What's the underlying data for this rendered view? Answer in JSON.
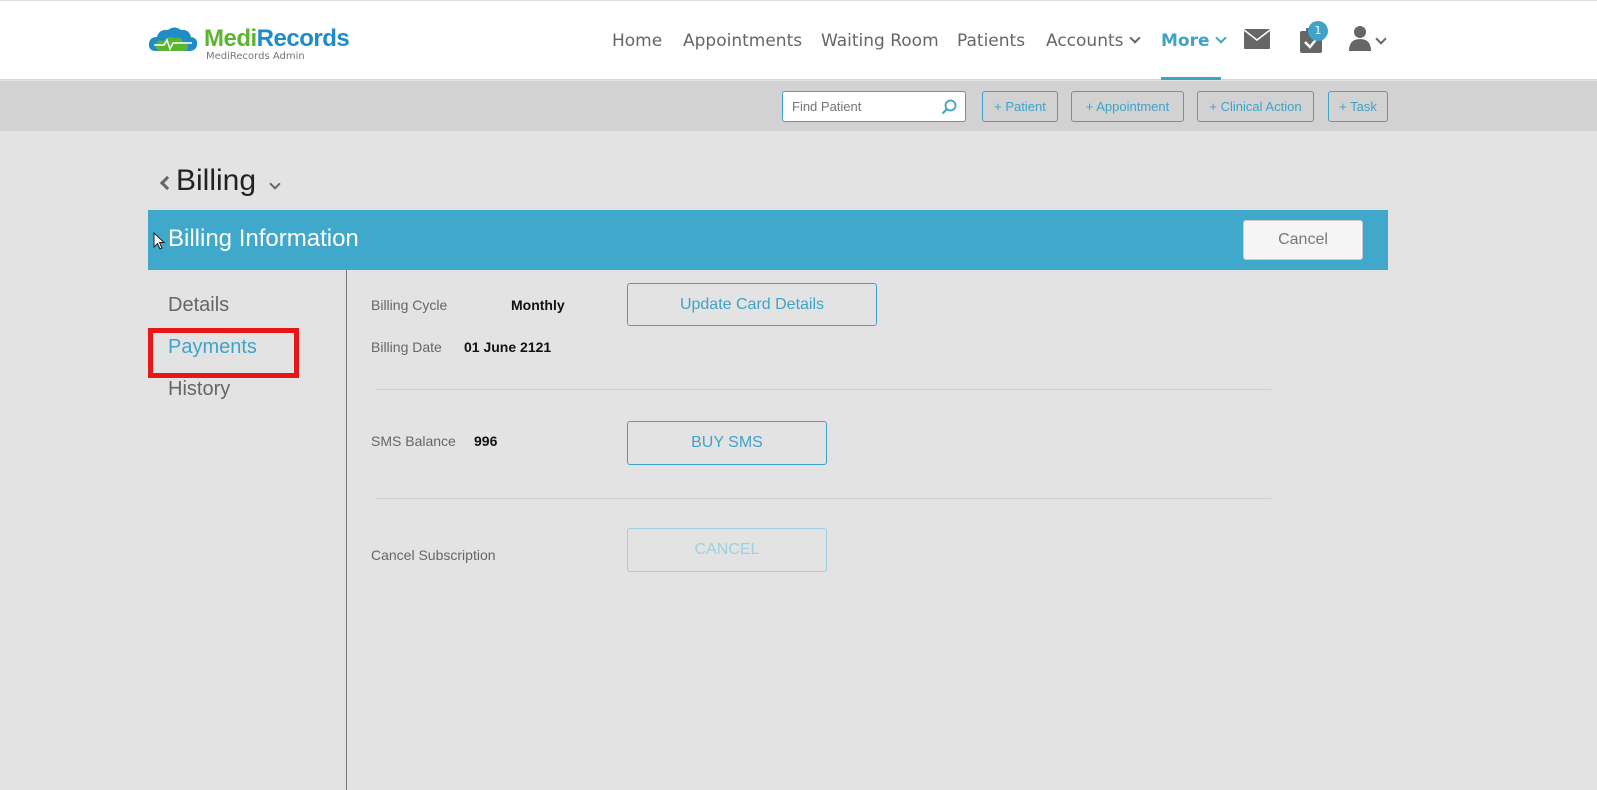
{
  "brand": {
    "name_part1": "Medi",
    "name_part2": "Records",
    "subtitle": "MediRecords Admin"
  },
  "nav": {
    "items": [
      {
        "label": "Home"
      },
      {
        "label": "Appointments"
      },
      {
        "label": "Waiting Room"
      },
      {
        "label": "Patients"
      },
      {
        "label": "Accounts"
      },
      {
        "label": "More"
      }
    ],
    "active": "More",
    "task_badge": "1"
  },
  "toolbar": {
    "find_placeholder": "Find Patient",
    "add_patient": "+ Patient",
    "add_appointment": "+ Appointment",
    "add_clinical_action": "+ Clinical Action",
    "add_task": "+ Task"
  },
  "page": {
    "title": "Billing"
  },
  "panel": {
    "title": "Billing Information",
    "cancel_label": "Cancel",
    "side_items": [
      {
        "label": "Details"
      },
      {
        "label": "Payments"
      },
      {
        "label": "History"
      }
    ],
    "active_side_item": "Payments",
    "billing_cycle_label": "Billing Cycle",
    "billing_cycle_value": "Monthly",
    "billing_date_label": "Billing Date",
    "billing_date_value": "01 June 2121",
    "update_card_label": "Update Card Details",
    "sms_balance_label": "SMS Balance",
    "sms_balance_value": "996",
    "buy_sms_label": "BUY SMS",
    "cancel_subscription_label": "Cancel Subscription",
    "cancel_button_label": "CANCEL"
  },
  "colors": {
    "accent": "#40a8ca",
    "highlight": "#e81616",
    "brand_green": "#5cb531",
    "brand_blue": "#1f8cc9"
  }
}
